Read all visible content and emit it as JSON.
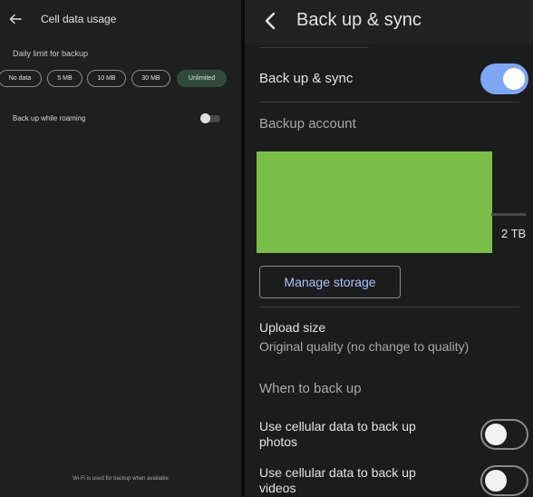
{
  "left_panel": {
    "title": "Cell data usage",
    "section_label": "Daily limit for backup",
    "chips": [
      {
        "label": "No data",
        "selected": false
      },
      {
        "label": "5 MB",
        "selected": false
      },
      {
        "label": "10 MB",
        "selected": false
      },
      {
        "label": "30 MB",
        "selected": false
      },
      {
        "label": "Unlimited",
        "selected": true
      }
    ],
    "roaming": {
      "label": "Back up while roaming",
      "enabled": false
    },
    "footer": "Wi-Fi is used for backup when available",
    "icons": {
      "back": "back-arrow-icon"
    }
  },
  "right_panel": {
    "title": "Back up & sync",
    "icons": {
      "back": "chevron-left-icon"
    },
    "backup_sync": {
      "label": "Back up & sync",
      "enabled": true
    },
    "backup_account": {
      "header": "Backup account",
      "storage_total": "2 TB"
    },
    "manage_storage_label": "Manage storage",
    "upload_size": {
      "title": "Upload size",
      "value": "Original quality (no change to quality)"
    },
    "when_header": "When to back up",
    "cellular_photos": {
      "label": "Use cellular data to back up photos",
      "enabled": false
    },
    "cellular_videos": {
      "label": "Use cellular data to back up videos",
      "enabled": false
    }
  },
  "colors": {
    "left_bg": "#1f1f1f",
    "right_bg": "#1c1c1c",
    "accent_blue": "#7ea6f2",
    "link_blue": "#a8c2ff",
    "selected_chip": "#2f4a3a",
    "account_block": "#78be47"
  }
}
